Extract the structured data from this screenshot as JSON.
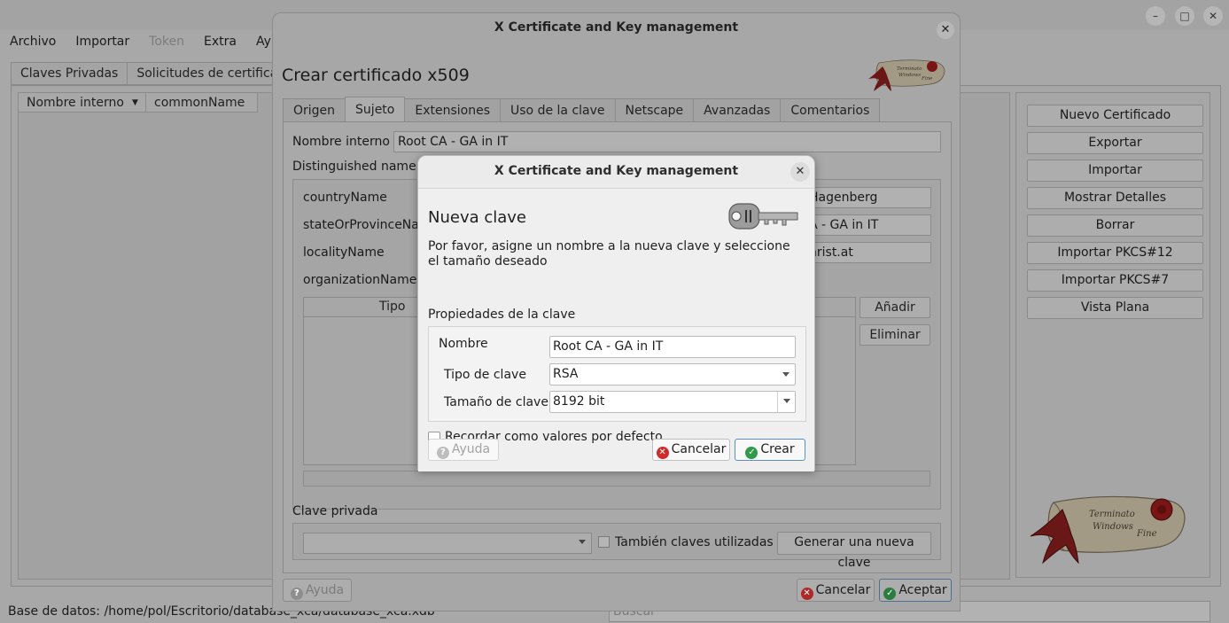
{
  "main_window": {
    "title_fragment": "X Certificate and Key management",
    "menu": [
      "Archivo",
      "Importar",
      "Token",
      "Extra",
      "Ayuda"
    ],
    "menu_disabled_index": 2,
    "tabs": [
      "Claves Privadas",
      "Solicitudes de certificado"
    ],
    "list_columns": [
      "Nombre interno",
      "commonName"
    ],
    "buttons": [
      "Nuevo Certificado",
      "Exportar",
      "Importar",
      "Mostrar Detalles",
      "Borrar",
      "Importar PKCS#12",
      "Importar PKCS#7",
      "Vista Plana"
    ],
    "status": "Base de datos: /home/pol/Escritorio/database_xca/database_xca.xdb",
    "search_placeholder": "Buscar"
  },
  "cert_dialog": {
    "title": "X Certificate and Key management",
    "heading": "Crear certificado x509",
    "tabs": [
      "Origen",
      "Sujeto",
      "Extensiones",
      "Uso de la clave",
      "Netscape",
      "Avanzadas",
      "Comentarios"
    ],
    "active_tab": "Sujeto",
    "internal_name_label": "Nombre interno",
    "internal_name_value": "Root CA - GA in IT",
    "dn_label": "Distinguished name",
    "dn_fields": [
      {
        "label": "countryName",
        "value": "Hagenberg"
      },
      {
        "label": "stateOrProvinceName",
        "value": "A - GA in IT"
      },
      {
        "label": "localityName",
        "value": "nrist.at"
      },
      {
        "label": "organizationName",
        "value": ""
      }
    ],
    "table_header": "Tipo",
    "add_button": "Añadir",
    "remove_button": "Eliminar",
    "private_key_label": "Clave privada",
    "used_keys_label": "También claves utilizadas",
    "generate_key_button": "Generar una nueva clave",
    "help_button": "Ayuda",
    "cancel_button": "Cancelar",
    "accept_button": "Aceptar"
  },
  "key_dialog": {
    "title": "X Certificate and Key management",
    "heading": "Nueva clave",
    "description": "Por favor, asigne un nombre a la nueva clave y seleccione el tamaño deseado",
    "properties_label": "Propiedades de la clave",
    "name_label": "Nombre",
    "name_value": "Root CA - GA in IT",
    "key_type_label": "Tipo de clave",
    "key_type_value": "RSA",
    "key_size_label": "Tamaño de clave",
    "key_size_value": "8192 bit",
    "remember_label": "Recordar como valores por defecto",
    "help_button": "Ayuda",
    "cancel_button": "Cancelar",
    "create_button": "Crear"
  },
  "seal_text": "Terminato Windows Fine",
  "colors": {
    "accent": "#5a8fc8",
    "cancel_red": "#d02b2b",
    "ok_green": "#2e9a4a",
    "seal_red": "#8b1a1a"
  }
}
